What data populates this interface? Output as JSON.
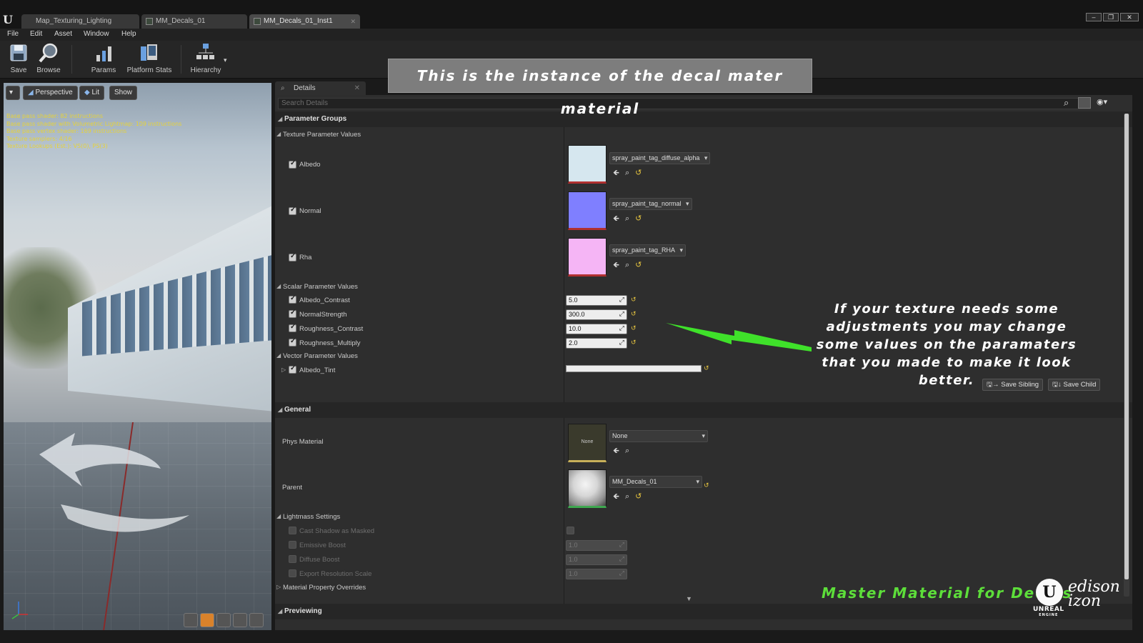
{
  "window": {
    "tabs": [
      {
        "label": "Map_Texturing_Lighting"
      },
      {
        "label": "MM_Decals_01"
      },
      {
        "label": "MM_Decals_01_Inst1"
      }
    ]
  },
  "menu": [
    "File",
    "Edit",
    "Asset",
    "Window",
    "Help"
  ],
  "toolbar": {
    "save": "Save",
    "browse": "Browse",
    "params": "Params",
    "platform_stats": "Platform Stats",
    "hierarchy": "Hierarchy"
  },
  "viewport": {
    "perspective": "Perspective",
    "lit": "Lit",
    "show": "Show",
    "stats": [
      "Base pass shader: 82 instructions",
      "Base pass shader with Volumetric Lightmap: 109 instructions",
      "Base pass vertex shader: 169 instructions",
      "Texture samplers: 4/16",
      "Texture Lookups (Est.): VS(0), PS(3)"
    ]
  },
  "details": {
    "tab_label": "Details",
    "search_placeholder": "Search Details",
    "parameter_groups": "Parameter Groups",
    "texture_params": {
      "header": "Texture Parameter Values",
      "items": [
        {
          "label": "Albedo",
          "asset": "spray_paint_tag_diffuse_alpha",
          "color": "#d6e7ef"
        },
        {
          "label": "Normal",
          "asset": "spray_paint_tag_normal",
          "color": "#7f7fff"
        },
        {
          "label": "Rha",
          "asset": "spray_paint_tag_RHA",
          "color": "#f5b5f5"
        }
      ]
    },
    "scalar_params": {
      "header": "Scalar Parameter Values",
      "items": [
        {
          "label": "Albedo_Contrast",
          "value": "5.0"
        },
        {
          "label": "NormalStrength",
          "value": "300.0"
        },
        {
          "label": "Roughness_Contrast",
          "value": "10.0"
        },
        {
          "label": "Roughness_Multiply",
          "value": "2.0"
        }
      ]
    },
    "vector_params": {
      "header": "Vector Parameter Values",
      "items": [
        {
          "label": "Albedo_Tint"
        }
      ]
    },
    "save_sibling": "Save Sibling",
    "save_child": "Save Child",
    "general": {
      "header": "General",
      "phys_material_label": "Phys Material",
      "phys_material_value": "None",
      "phys_material_thumb": "None",
      "parent_label": "Parent",
      "parent_value": "MM_Decals_01"
    },
    "lightmass": {
      "header": "Lightmass Settings",
      "cast_shadow": "Cast Shadow as Masked",
      "emissive_boost": "Emissive Boost",
      "emissive_boost_value": "1.0",
      "diffuse_boost": "Diffuse Boost",
      "diffuse_boost_value": "1.0",
      "export_resolution": "Export Resolution Scale",
      "export_resolution_value": "1.0"
    },
    "material_overrides": "Material Property Overrides",
    "previewing": "Previewing"
  },
  "overlays": {
    "title": "This is the instance of the decal mater material",
    "note": "If your texture needs some adjustments you may change some values on the paramaters that you made to make it look better.",
    "brand": "Master Material for Decals",
    "logo_text": "UNREAL",
    "logo_subtext": "ENGINE",
    "signature": "edison izon",
    "arrow_color": "#3fe12a"
  }
}
